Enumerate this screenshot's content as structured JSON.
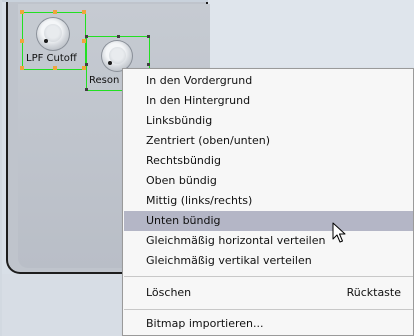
{
  "knobs": [
    {
      "label": "LPF Cutoff"
    },
    {
      "label": "Reson"
    }
  ],
  "context_menu": {
    "items": [
      {
        "label": "In den Vordergrund",
        "shortcut": ""
      },
      {
        "label": "In den Hintergrund",
        "shortcut": ""
      },
      {
        "label": "Linksbündig",
        "shortcut": ""
      },
      {
        "label": "Zentriert (oben/unten)",
        "shortcut": ""
      },
      {
        "label": "Rechtsbündig",
        "shortcut": ""
      },
      {
        "label": "Oben bündig",
        "shortcut": ""
      },
      {
        "label": "Mittig (links/rechts)",
        "shortcut": ""
      },
      {
        "label": "Unten bündig",
        "shortcut": "",
        "highlighted": true
      },
      {
        "label": "Gleichmäßig horizontal verteilen",
        "shortcut": ""
      },
      {
        "label": "Gleichmäßig vertikal verteilen",
        "shortcut": ""
      },
      {
        "label": "Löschen",
        "shortcut": "Rücktaste"
      },
      {
        "label": "Bitmap importieren...",
        "shortcut": ""
      }
    ]
  },
  "colors": {
    "highlight": "#b4b6c6",
    "selection_outline": "#22e022",
    "handle": "#f0a53c"
  }
}
